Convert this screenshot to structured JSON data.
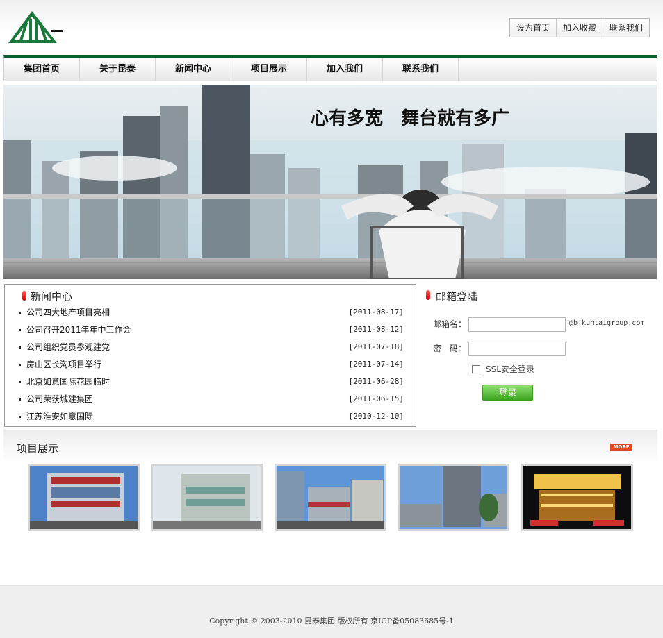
{
  "header": {
    "logo_alt": "昆泰集团",
    "top_links": [
      "设为首页",
      "加入收藏",
      "联系我们"
    ]
  },
  "nav": {
    "items": [
      "集团首页",
      "关于昆泰",
      "新闻中心",
      "项目展示",
      "加入我们",
      "联系我们"
    ],
    "accent_color": "#0d5f2a"
  },
  "banner": {
    "slogan": "心有多宽　舞台就有多广"
  },
  "news": {
    "title": "新闻中心",
    "items": [
      {
        "title": "公司四大地产项目亮相",
        "date": "[2011-08-17]"
      },
      {
        "title": "公司召开2011年年中工作会",
        "date": "[2011-08-12]"
      },
      {
        "title": "公司组织党员参观建党",
        "date": "[2011-07-18]"
      },
      {
        "title": "房山区长沟项目举行",
        "date": "[2011-07-14]"
      },
      {
        "title": "北京如意国际花园临时",
        "date": "[2011-06-28]"
      },
      {
        "title": "公司荣获城建集团",
        "date": "[2011-06-15]"
      },
      {
        "title": "江苏淮安如意国际",
        "date": "[2010-12-10]"
      }
    ]
  },
  "login": {
    "title": "邮箱登陆",
    "email_label": "邮箱名：",
    "email_value": "",
    "domain": "@bjkuntaigroup.com",
    "password_label": "密　码：",
    "password_value": "",
    "ssl_label": "SSL安全登录",
    "submit_label": "登录"
  },
  "projects": {
    "title": "项目展示",
    "more_label": "MORE"
  },
  "footer": {
    "copyright": "Copyright © 2003-2010 昆泰集团 版权所有 京ICP备05083685号-1"
  }
}
